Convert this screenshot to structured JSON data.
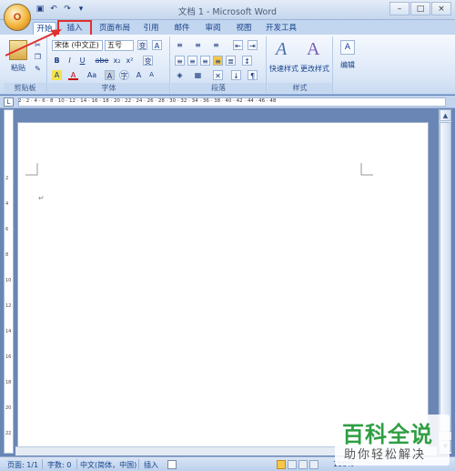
{
  "window": {
    "title": "文档 1 - Microsoft Word",
    "controls": [
      "–",
      "□",
      "×"
    ]
  },
  "office_button": {
    "glyph": "O"
  },
  "quick_access": [
    "save-icon",
    "undo-icon",
    "redo-icon",
    "customize-icon"
  ],
  "ribbon_tabs": [
    {
      "label": "开始",
      "active": true
    },
    {
      "label": "插入",
      "highlighted": true
    },
    {
      "label": "页面布局"
    },
    {
      "label": "引用"
    },
    {
      "label": "邮件"
    },
    {
      "label": "审阅"
    },
    {
      "label": "视图"
    },
    {
      "label": "开发工具"
    }
  ],
  "ribbon": {
    "clipboard": {
      "paste_label": "粘贴",
      "group_label": "剪贴板"
    },
    "font": {
      "font_name": "宋体 (中文正)",
      "font_size": "五号",
      "group_label": "字体",
      "buttons_row2": [
        "B",
        "I",
        "U",
        "abe",
        "x₂",
        "x²"
      ],
      "buttons_row3": [
        "A",
        "Aa",
        "A",
        "A",
        "A",
        "A"
      ]
    },
    "paragraph": {
      "group_label": "段落"
    },
    "styles": {
      "quick_styles": "快速样式",
      "change_styles": "更改样式",
      "group_label": "样式"
    },
    "editing": {
      "label": "编辑"
    }
  },
  "ruler": {
    "numbers": "2 · 2 · 4 · 6 · 8 · 10 · 12 · 14 · 16 · 18 · 20 · 22 · 24 · 26 · 28 · 30 · 32 · 34 · 36 · 38 · 40 · 42 · 44 · 46 · 48",
    "vertical_numbers": [
      "2",
      "4",
      "6",
      "8",
      "10",
      "12",
      "14",
      "16",
      "18",
      "20",
      "22"
    ]
  },
  "document": {
    "paragraph_mark": "↵"
  },
  "status_bar": {
    "page": "页面: 1/1",
    "words": "字数: 0",
    "language": "中文(简体，中国)",
    "mode": "插入",
    "zoom": "100%"
  },
  "watermark": {
    "title": "百科全说",
    "subtitle": "助你轻松解决"
  }
}
